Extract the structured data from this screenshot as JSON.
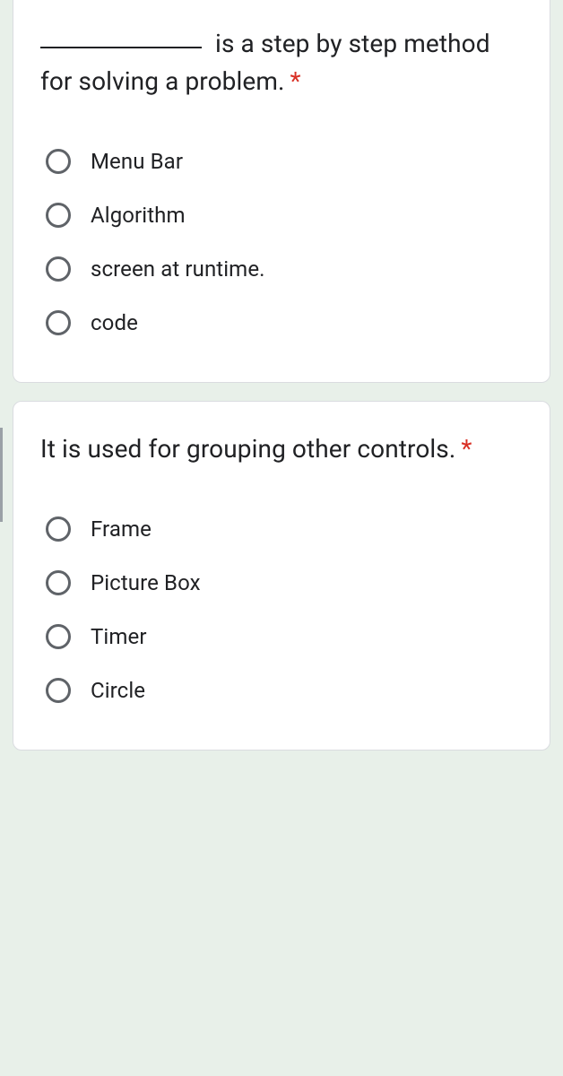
{
  "questions": [
    {
      "blank_prefix": true,
      "text": " is a step by step method for solving a problem.",
      "required": "*",
      "options": [
        "Menu Bar",
        "Algorithm",
        "screen at runtime.",
        "code"
      ]
    },
    {
      "blank_prefix": false,
      "text": "It is used for grouping other controls.",
      "required": "*",
      "options": [
        "Frame",
        "Picture Box",
        "Timer",
        "Circle"
      ]
    }
  ]
}
